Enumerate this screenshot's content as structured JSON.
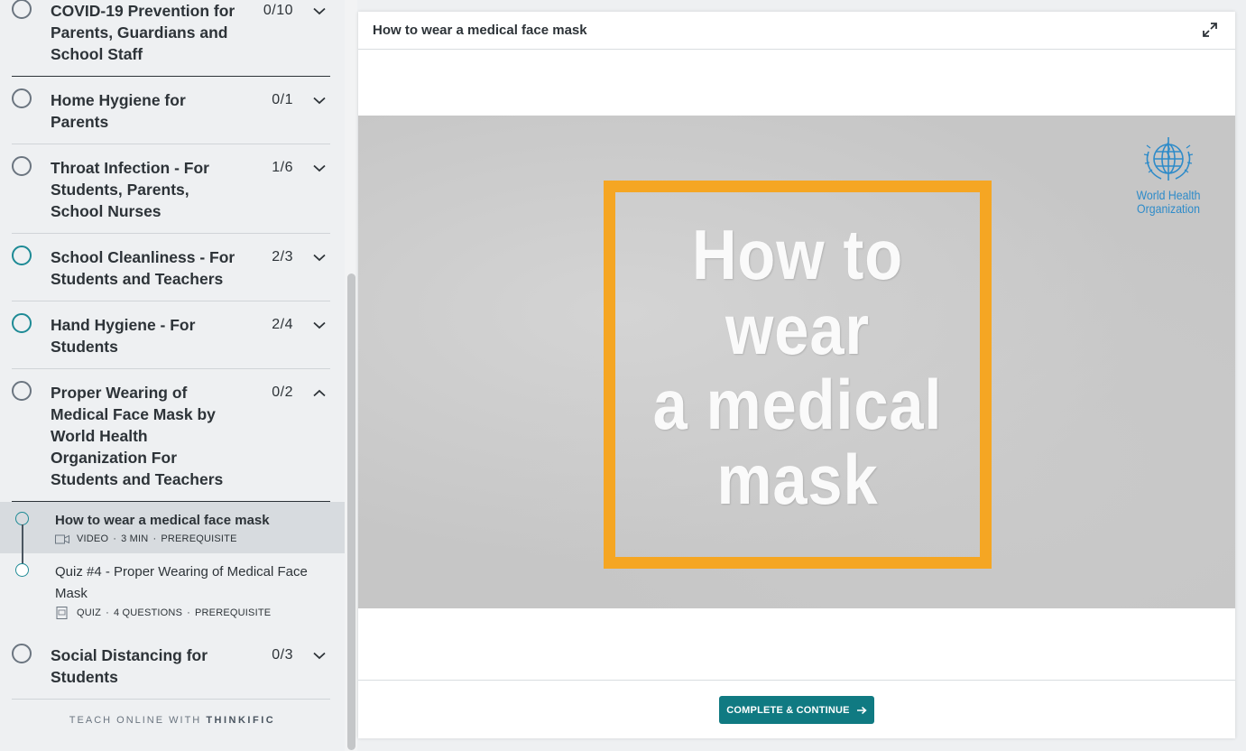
{
  "sidebar": {
    "chapters": [
      {
        "title": "COVID-19 Prevention for Parents, Guardians and School Staff",
        "count": "0/10",
        "state": "empty",
        "expanded": false,
        "bottom_rule": "dark"
      },
      {
        "title": "Home Hygiene for Parents",
        "count": "0/1",
        "state": "empty",
        "expanded": false
      },
      {
        "title": "Throat Infection - For Students, Parents, School Nurses",
        "count": "1/6",
        "state": "empty",
        "expanded": false
      },
      {
        "title": "School Cleanliness - For Students and Teachers",
        "count": "2/3",
        "state": "progress",
        "expanded": false
      },
      {
        "title": "Hand Hygiene - For Students",
        "count": "2/4",
        "state": "progress",
        "expanded": false
      },
      {
        "title": "Proper Wearing of Medical Face Mask by World Health Organization For Students and Teachers",
        "count": "0/2",
        "state": "empty",
        "expanded": true
      },
      {
        "title": "Social Distancing for Students",
        "count": "0/3",
        "state": "empty",
        "expanded": false
      }
    ],
    "lessons": [
      {
        "title": "How to wear a medical face mask",
        "type": "Video",
        "detail": "3 min",
        "tag": "Prerequisite",
        "icon": "video-icon",
        "active": true
      },
      {
        "title": "Quiz #4 - Proper Wearing of Medical Face Mask",
        "type": "Quiz",
        "detail": "4 Questions",
        "tag": "Prerequisite",
        "icon": "quiz-icon",
        "active": false
      }
    ],
    "footer": {
      "prefix": "TEACH ONLINE WITH",
      "brand": "THINKIFIC"
    }
  },
  "main": {
    "lesson_title": "How to wear a medical face mask",
    "expand_icon": "expand-icon",
    "video": {
      "text_lines": [
        "How to",
        "wear",
        "a medical",
        "mask"
      ],
      "logo_lines": [
        "World Health",
        "Organization"
      ],
      "frame_color": "#f5a623"
    },
    "continue_label": "COMPLETE & CONTINUE",
    "continue_icon": "arrow-right-icon"
  },
  "colors": {
    "accent": "#107a82",
    "progress_ring": "#1d8a95",
    "sidebar_bg": "#eef0f2"
  }
}
